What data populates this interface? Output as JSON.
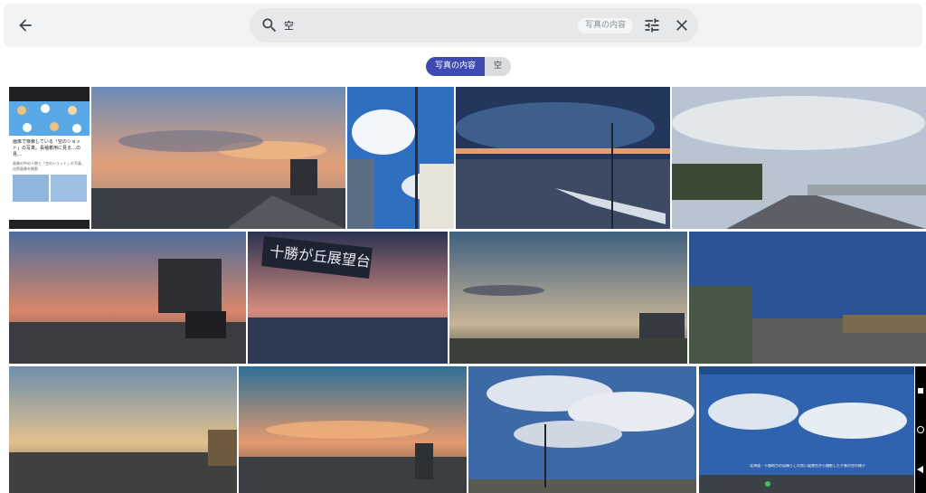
{
  "search": {
    "query": "空",
    "category_chip": "写真の内容"
  },
  "breadcrumbs": {
    "category": "写真の内容",
    "term": "空"
  },
  "thumb": {
    "title": "画像で検索している「空のショット」の写真。長袖着用に見る…の見…",
    "subtitle": "画像の中の人物と「空のショット」の写真、自然画像を検索"
  },
  "signboard": "十勝が丘展望台",
  "caption": "北海道・十勝地方の見晴らしの良い展望台から撮影した夕景の空の様子",
  "icons": [
    "back-arrow-icon",
    "search-icon",
    "tune-icon",
    "close-icon"
  ],
  "colors": {
    "accent": "#3c4ab1",
    "topbar": "#f1f3f4"
  }
}
